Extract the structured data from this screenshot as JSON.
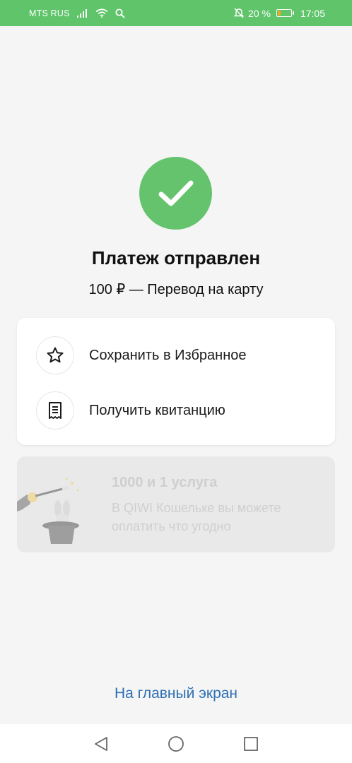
{
  "status_bar": {
    "carrier": "MTS RUS",
    "battery_percent": "20 %",
    "battery_level": 0.2,
    "time": "17:05",
    "icons": [
      "signal-icon",
      "wifi-icon",
      "search-icon",
      "mute-bell-icon",
      "battery-icon"
    ]
  },
  "result": {
    "icon": "checkmark-icon",
    "title": "Платеж отправлен",
    "subtitle": "100 ₽ — Перевод на карту"
  },
  "actions": [
    {
      "icon": "star-icon",
      "label": "Сохранить в Избранное"
    },
    {
      "icon": "receipt-icon",
      "label": "Получить квитанцию"
    }
  ],
  "promo": {
    "title": "1000 и 1 услуга",
    "text": "В QIWI Кошельке вы можете оплатить что угодно"
  },
  "home_link": "На главный экран",
  "nav": [
    "back-icon",
    "home-icon",
    "recents-icon"
  ],
  "colors": {
    "accent_green": "#5fc46a",
    "success_circle": "#66c36d",
    "link_blue": "#2f6fb3",
    "background": "#f5f5f5"
  }
}
